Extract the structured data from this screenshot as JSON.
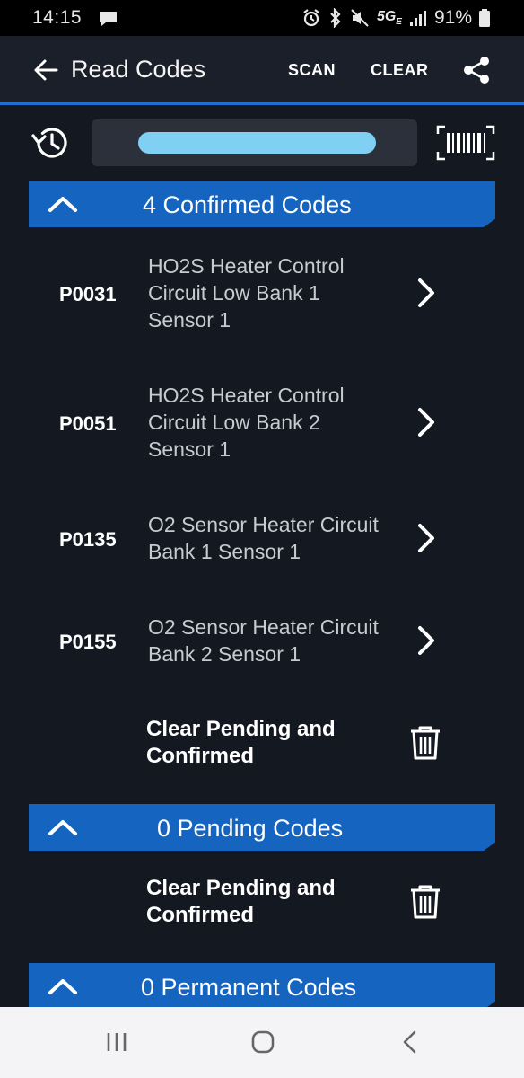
{
  "status_bar": {
    "time": "14:15",
    "network": "5G",
    "network_suffix": "E",
    "battery": "91%"
  },
  "app_bar": {
    "title": "Read Codes",
    "scan_label": "SCAN",
    "clear_label": "CLEAR"
  },
  "sections": {
    "confirmed": {
      "label": "4 Confirmed Codes",
      "codes": [
        {
          "code": "P0031",
          "desc_lines": [
            "HO2S Heater Control",
            "Circuit Low Bank 1",
            "Sensor 1"
          ]
        },
        {
          "code": "P0051",
          "desc_lines": [
            "HO2S Heater Control",
            "Circuit Low Bank 2",
            "Sensor 1"
          ]
        },
        {
          "code": "P0135",
          "desc_lines": [
            "O2 Sensor Heater Circuit",
            "Bank 1 Sensor 1"
          ]
        },
        {
          "code": "P0155",
          "desc_lines": [
            "O2 Sensor Heater Circuit",
            "Bank 2 Sensor 1"
          ]
        }
      ],
      "clear_lines": [
        "Clear Pending and",
        "Confirmed"
      ]
    },
    "pending": {
      "label": "0 Pending Codes",
      "clear_lines": [
        "Clear Pending and",
        "Confirmed"
      ]
    },
    "permanent": {
      "label": "0 Permanent Codes"
    }
  },
  "colors": {
    "background": "#141821",
    "app_bar": "#1a1f2a",
    "accent": "#1565c0",
    "redaction": "#7fd0f2"
  }
}
